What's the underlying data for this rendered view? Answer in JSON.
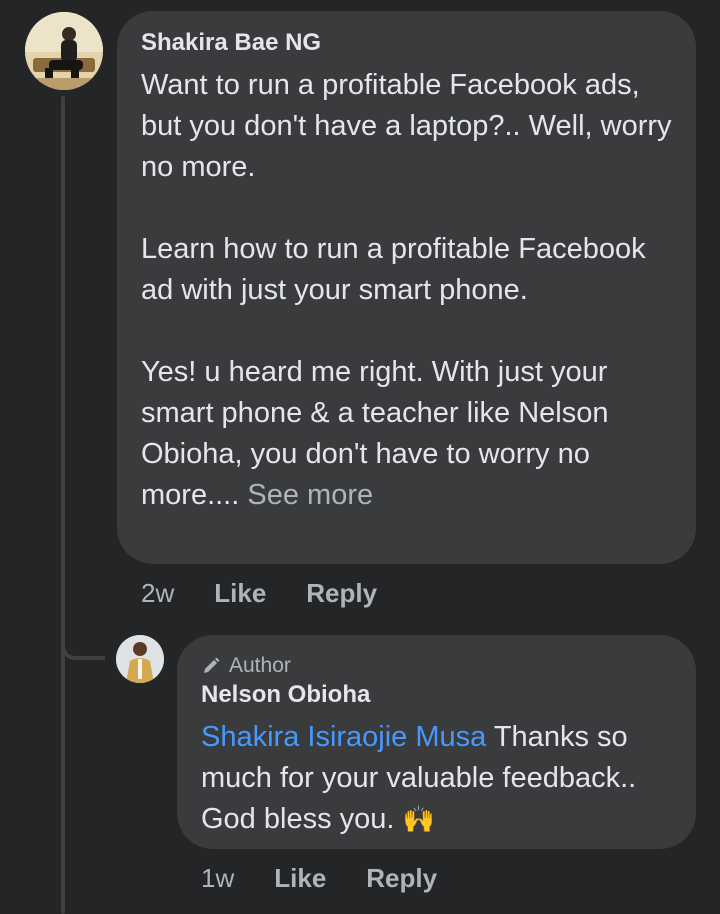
{
  "comment": {
    "author": "Shakira Bae NG",
    "paragraphs": [
      "Want to run a profitable Facebook ads, but you don't have a laptop?.. Well, worry no more.",
      "Learn how to run a profitable Facebook ad with just your smart phone.",
      " Yes! u heard me right. With just your smart phone & a teacher like Nelson Obioha, you don't have to worry no more...."
    ],
    "see_more": "See more",
    "time": "2w",
    "like_label": "Like",
    "reply_label": "Reply"
  },
  "reply": {
    "badge": "Author",
    "author": "Nelson Obioha",
    "mention": "Shakira Isiraojie Musa",
    "text": "Thanks so much for your valuable feedback.. God bless you.",
    "emoji": "🙌",
    "time": "1w",
    "like_label": "Like",
    "reply_label": "Reply"
  },
  "colors": {
    "background": "#242526",
    "bubble": "#3a3b3c",
    "mention": "#4599ff",
    "secondary_text": "#b0b3b8"
  }
}
